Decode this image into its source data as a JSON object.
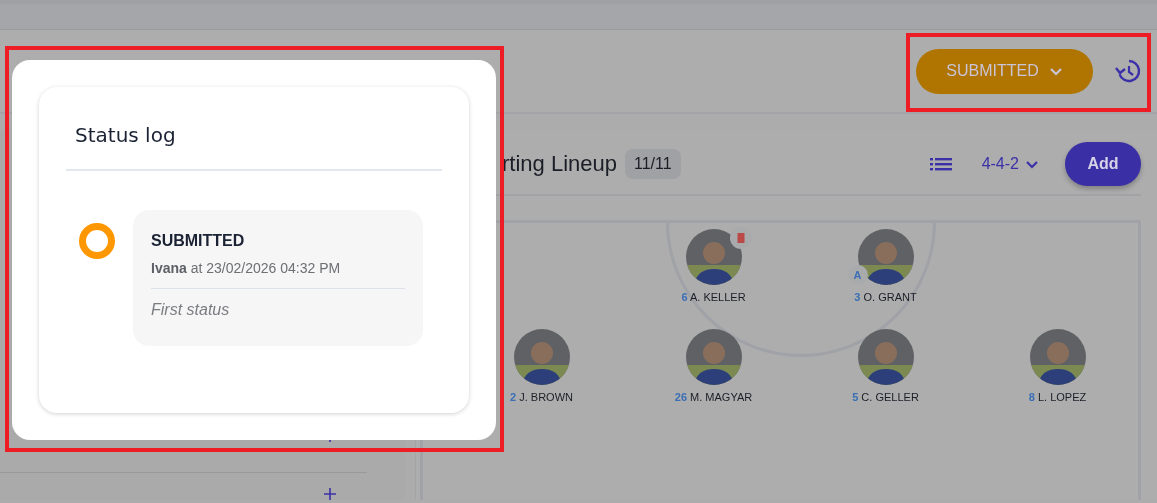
{
  "header": {
    "status_button": {
      "label": "SUBMITTED",
      "color": "#b07400",
      "highlighted": true
    }
  },
  "lineup": {
    "title": "rting Lineup",
    "count": "11/11",
    "formation": "4-4-2",
    "add_button": "Add",
    "rows": [
      {
        "players": [
          {
            "number": "6",
            "name": "A. KELLER",
            "badge": {
              "kind": "card"
            }
          },
          {
            "number": "3",
            "name": "O. GRANT",
            "badge": {
              "kind": "captain",
              "label": "A"
            }
          }
        ]
      },
      {
        "players": [
          {
            "number": "2",
            "name": "J. BROWN"
          },
          {
            "number": "26",
            "name": "M. MAGYAR"
          },
          {
            "number": "5",
            "name": "C. GELLER"
          },
          {
            "number": "8",
            "name": "L. LOPEZ"
          }
        ]
      }
    ]
  },
  "status_log": {
    "title": "Status log",
    "highlighted": true,
    "entries": [
      {
        "status": "SUBMITTED",
        "color": "#ff9800",
        "meta": "**Ivana** at 23/02/2026 04:32 PM",
        "note": "First status"
      }
    ]
  }
}
